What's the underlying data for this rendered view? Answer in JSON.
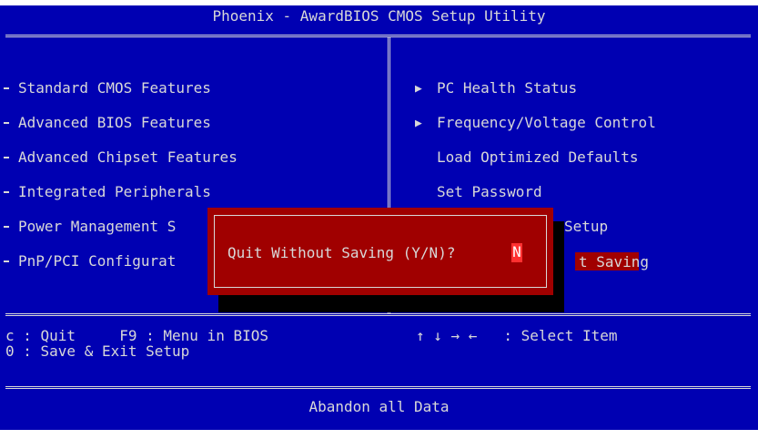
{
  "title": "Phoenix - AwardBIOS CMOS Setup Utility",
  "left_menu": [
    {
      "label": "Standard CMOS Features"
    },
    {
      "label": "Advanced BIOS Features"
    },
    {
      "label": "Advanced Chipset Features"
    },
    {
      "label": "Integrated Peripherals"
    },
    {
      "label": "Power Management S"
    },
    {
      "label": "PnP/PCI Configurat"
    }
  ],
  "right_menu": [
    {
      "label": "PC Health Status",
      "submenu": true
    },
    {
      "label": "Frequency/Voltage Control",
      "submenu": true
    },
    {
      "label": "Load Optimized Defaults",
      "submenu": false
    },
    {
      "label": "Set Password",
      "submenu": false
    },
    {
      "label": "Setup",
      "submenu": false
    },
    {
      "label": "t Saving",
      "submenu": false,
      "selected": true
    }
  ],
  "help": {
    "line1_left": "c : Quit     F9 : Menu in BIOS",
    "line1_right": "↑ ↓ → ←   : Select Item",
    "line2_left": "0 : Save & Exit Setup"
  },
  "footer": "Abandon all Data",
  "dialog": {
    "prompt": "Quit Without Saving (Y/N)?",
    "value": "N"
  },
  "colors": {
    "background": "#0000b2",
    "text": "#d8d8d8",
    "dialog": "#a00000",
    "highlight": "#ff3030"
  }
}
